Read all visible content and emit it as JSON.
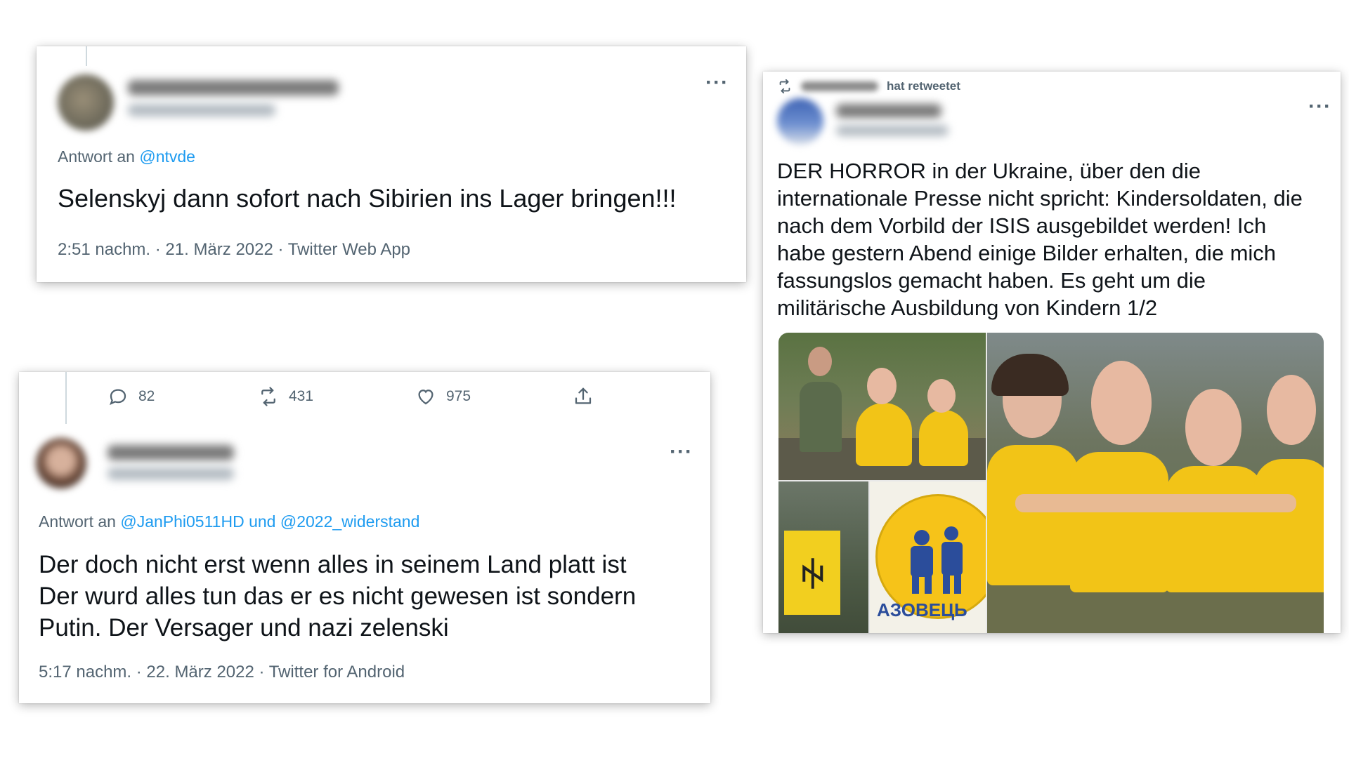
{
  "colors": {
    "link": "#1d9bf0",
    "secondary_text": "#536471",
    "primary_text": "#0f1419",
    "azov_yellow": "#f6c319",
    "azov_blue": "#2b4d9b"
  },
  "tweet_a": {
    "reply_prefix": "Antwort an",
    "reply_mention": "@ntvde",
    "text": "Selenskyj dann sofort nach Sibirien ins Lager bringen!!!",
    "timestamp": "2:51 nachm. · 21. März 2022 · Twitter Web App",
    "more_icon": "more-horizontal-icon"
  },
  "tweet_b": {
    "actions": {
      "reply_count": "82",
      "retweet_count": "431",
      "like_count": "975"
    },
    "reply_prefix": "Antwort an",
    "reply_mention_1": "@JanPhi0511HD",
    "reply_joiner": "und",
    "reply_mention_2": "@2022_widerstand",
    "text_line_1": "Der doch nicht erst wenn alles in seinem Land platt ist",
    "text_line_2": "Der wurd alles tun das er es nicht gewesen ist sondern",
    "text_line_3": "Putin. Der Versager und nazi zelenski",
    "timestamp": "5:17 nachm. · 22. März 2022 · Twitter for Android"
  },
  "tweet_c": {
    "retweet_suffix": "hat retweetet",
    "text_line_1": "DER HORROR in der Ukraine, über den die",
    "text_line_2": "internationale Presse nicht spricht: Kindersoldaten, die",
    "text_line_3": "nach dem Vorbild der ISIS ausgebildet werden! Ich",
    "text_line_4": "habe gestern Abend einige Bilder erhalten, die mich",
    "text_line_5": "fassungslos gemacht haben. Es geht um die",
    "text_line_6": "militärische Ausbildung von Kindern 1/2",
    "media_logo_text": "АЗОВЕЦЬ",
    "media_flag_glyph": "ꑭ"
  }
}
